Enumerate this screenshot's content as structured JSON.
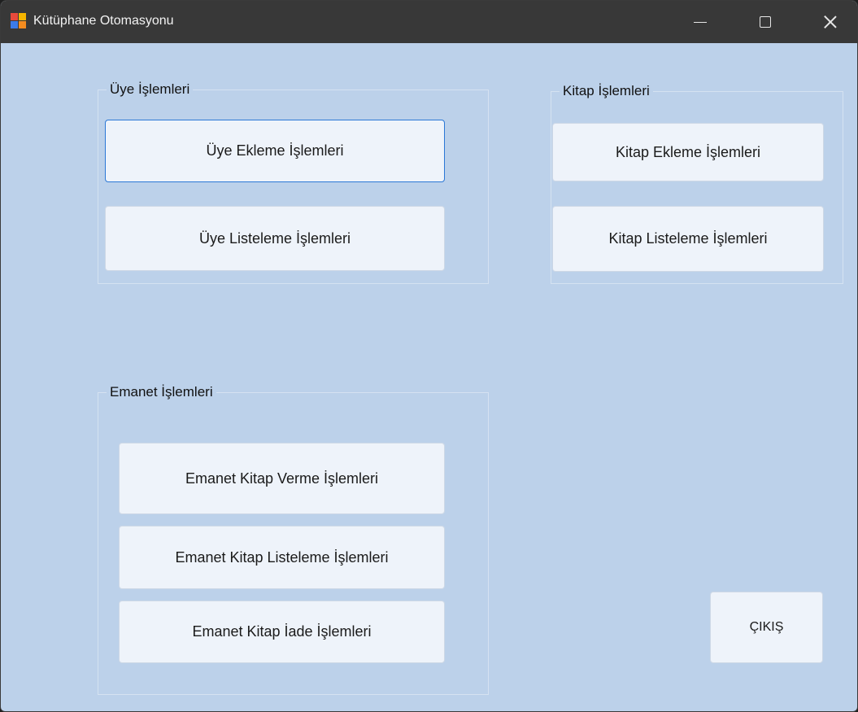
{
  "window": {
    "title": "Kütüphane Otomasyonu"
  },
  "groups": {
    "uye": {
      "legend": "Üye İşlemleri",
      "buttons": [
        "Üye Ekleme İşlemleri",
        "Üye Listeleme İşlemleri"
      ]
    },
    "kitap": {
      "legend": "Kitap İşlemleri",
      "buttons": [
        "Kitap Ekleme İşlemleri",
        "Kitap Listeleme İşlemleri"
      ]
    },
    "emanet": {
      "legend": "Emanet İşlemleri",
      "buttons": [
        "Emanet Kitap Verme İşlemleri",
        "Emanet Kitap Listeleme İşlemleri",
        "Emanet Kitap İade İşlemleri"
      ]
    }
  },
  "exit_label": "ÇIKIŞ",
  "colors": {
    "titlebar": "#383838",
    "client": "#bcd1ea",
    "button": "#eef3fa",
    "focus": "#2b78d6"
  },
  "icons": [
    "app-icon",
    "minimize-icon",
    "maximize-icon",
    "close-icon"
  ]
}
